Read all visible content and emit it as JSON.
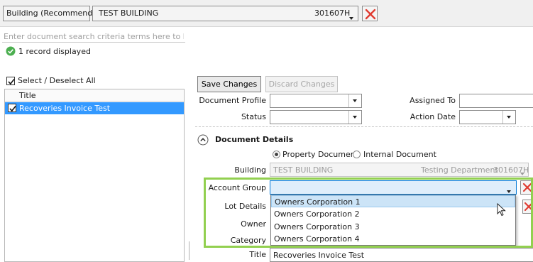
{
  "topbar": {
    "selector_label": "Building (Recommended)",
    "building_name": "TEST BUILDING",
    "building_code": "301607H"
  },
  "search": {
    "placeholder": "Enter document search criteria terms here to begin"
  },
  "status": {
    "records": "1 record displayed"
  },
  "left": {
    "select_all": "Select / Deselect All",
    "column_title": "Title",
    "rows": [
      {
        "title": "Recoveries Invoice Test",
        "checked": true
      }
    ]
  },
  "toolbar": {
    "save_label": "Save Changes",
    "discard_label": "Discard Changes"
  },
  "form": {
    "document_profile_label": "Document Profile",
    "assigned_to_label": "Assigned To",
    "status_label": "Status",
    "action_date_label": "Action Date",
    "section_title": "Document Details",
    "radio_property": "Property Document",
    "radio_internal": "Internal Document",
    "building_label": "Building",
    "building_value": "TEST BUILDING",
    "building_dept": "Testing Department",
    "building_code": "301607H",
    "account_group_label": "Account Group",
    "lot_details_label": "Lot Details",
    "owner_label": "Owner",
    "category_label": "Category",
    "title_label": "Title",
    "title_value": "Recoveries Invoice Test"
  },
  "dropdown": {
    "options": [
      "Owners Corporation 1",
      "Owners Corporation 2",
      "Owners Corporation 3",
      "Owners Corporation 4"
    ],
    "highlighted_index": 0
  },
  "colors": {
    "selection_blue": "#3399ff",
    "hover_blue": "#cce4f7",
    "callout_green": "#92d050",
    "delete_red": "#e03c31",
    "success_green": "#4caf50"
  },
  "icons": [
    "chevron-down-icon",
    "delete-x-icon",
    "check-circle-icon",
    "collapse-chevron-icon",
    "mouse-cursor-icon"
  ]
}
